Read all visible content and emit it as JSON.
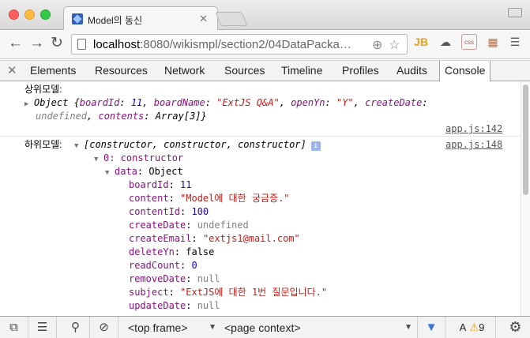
{
  "browser": {
    "tab_title": "Model의 동신",
    "tab_close": "✕",
    "url_host": "localhost",
    "url_rest": ":8080/wikismpl/section2/04DataPacka…",
    "extensions": [
      "JB",
      "☁",
      "css",
      "▦",
      "☰"
    ]
  },
  "devtools": {
    "close": "✕",
    "tabs": [
      "Elements",
      "Resources",
      "Network",
      "Sources",
      "Timeline",
      "Profiles",
      "Audits",
      "Console"
    ],
    "active_tab": "Console"
  },
  "console": {
    "parent_label": "상위모델:",
    "parent_obj_prefix": "Object {",
    "parent_board_id_key": "boardId",
    "parent_board_id_val": "11",
    "parent_board_name_key": "boardName",
    "parent_board_name_val": "\"ExtJS Q&A\"",
    "parent_openyn_key": "openYn",
    "parent_openyn_val": "\"Y\"",
    "parent_createdate_key": "createDate",
    "parent_createdate_val": "undefined",
    "parent_contents_key": "contents",
    "parent_contents_val": "Array[3]}",
    "parent_link": "app.js:142",
    "child_label": "하위모델:",
    "child_array": "[constructor, constructor, constructor]",
    "child_link": "app.js:148",
    "item0": "0: constructor",
    "data_key": "data",
    "data_val": "Object",
    "fields": [
      {
        "key": "boardId",
        "val": "11",
        "kind": "num"
      },
      {
        "key": "content",
        "val": "\"Model에 대한 궁금증.\"",
        "kind": "str"
      },
      {
        "key": "contentId",
        "val": "100",
        "kind": "num"
      },
      {
        "key": "createDate",
        "val": "undefined",
        "kind": "gray"
      },
      {
        "key": "createEmail",
        "val": "\"extjs1@mail.com\"",
        "kind": "str"
      },
      {
        "key": "deleteYn",
        "val": "false",
        "kind": "plain"
      },
      {
        "key": "readCount",
        "val": "0",
        "kind": "num"
      },
      {
        "key": "removeDate",
        "val": "null",
        "kind": "gray"
      },
      {
        "key": "subject",
        "val": "\"ExtJS에 대한 1번 질문입니다.\"",
        "kind": "str"
      },
      {
        "key": "updateDate",
        "val": "null",
        "kind": "gray"
      }
    ]
  },
  "statusbar": {
    "frame_select": "<top frame>",
    "context_select": "<page context>",
    "warning_count": "9"
  }
}
